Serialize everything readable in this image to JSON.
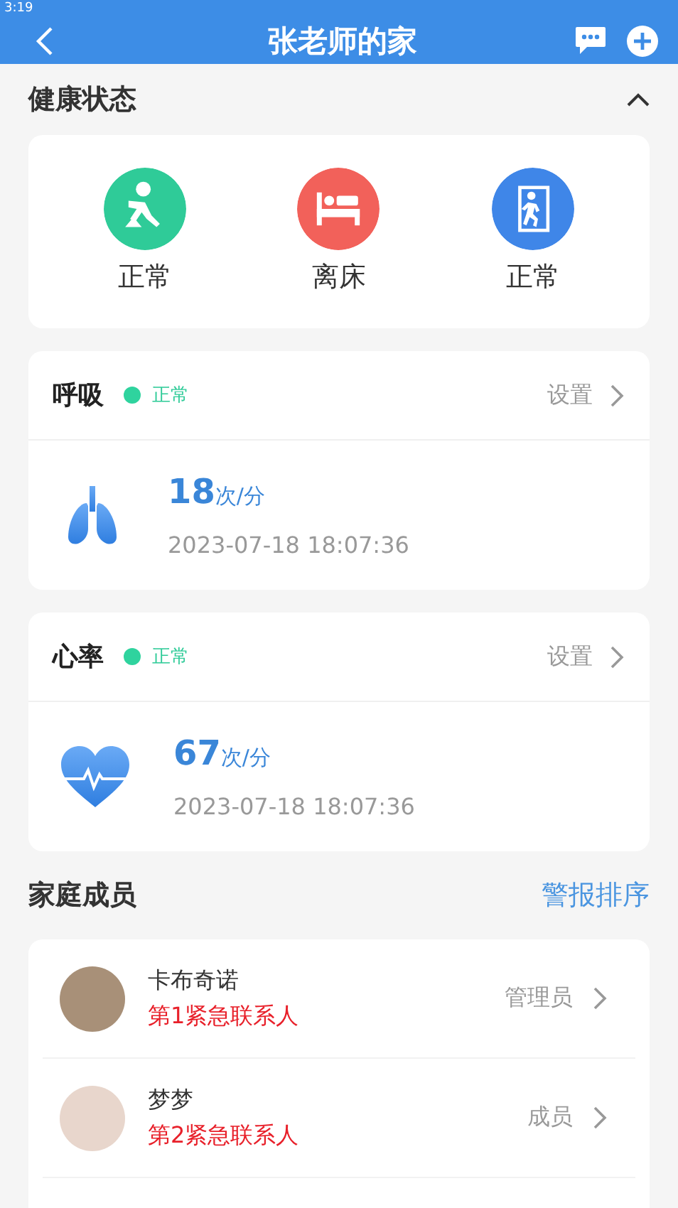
{
  "status_bar": {
    "time": "3:19"
  },
  "header": {
    "title": "张老师的家"
  },
  "health": {
    "title": "健康状态",
    "expanded": true,
    "items": [
      {
        "kind": "fall",
        "label": "正常",
        "color": "#2fcb98"
      },
      {
        "kind": "bed",
        "label": "离床",
        "color": "#f2615a"
      },
      {
        "kind": "exit",
        "label": "正常",
        "color": "#3f86e8"
      }
    ]
  },
  "metrics": [
    {
      "kind": "lungs",
      "name": "呼吸",
      "status": "正常",
      "color": "#2fd39e",
      "settings": "设置",
      "value": "18",
      "unit": "次/分",
      "time": "2023-07-18 18:07:36"
    },
    {
      "kind": "heart",
      "name": "心率",
      "status": "正常",
      "color": "#2fd39e",
      "settings": "设置",
      "value": "67",
      "unit": "次/分",
      "time": "2023-07-18 18:07:36"
    }
  ],
  "family": {
    "title": "家庭成员",
    "action": "警报排序",
    "members": [
      {
        "name": "卡布奇诺",
        "contact": "第1紧急联系人",
        "role": "管理员"
      },
      {
        "name": "梦梦",
        "contact": "第2紧急联系人",
        "role": "成员"
      }
    ]
  }
}
